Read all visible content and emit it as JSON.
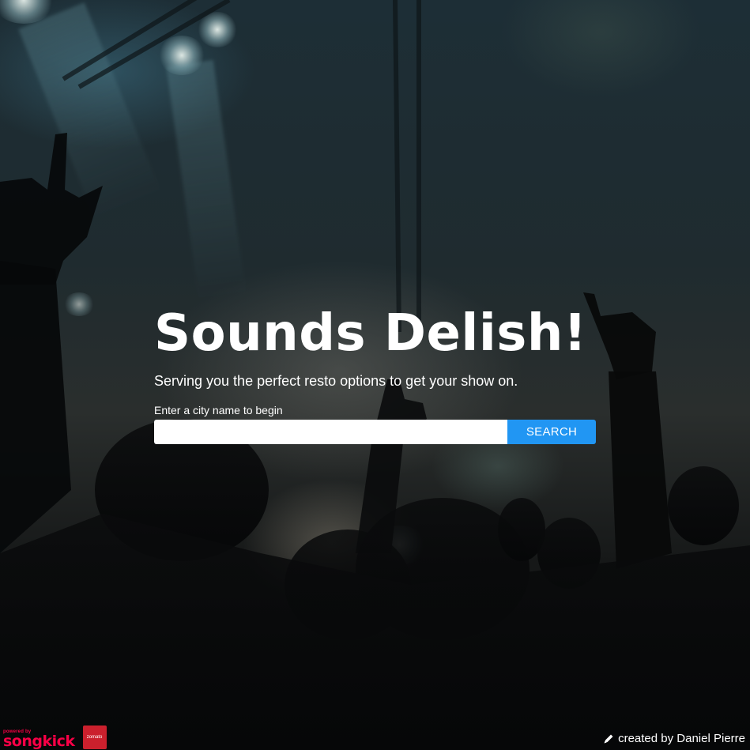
{
  "hero": {
    "title": "Sounds Delish!",
    "subtitle": "Serving you the perfect resto options to get your show on.",
    "prompt": "Enter a city name to begin"
  },
  "search": {
    "value": "",
    "placeholder": "",
    "button_label": "SEARCH"
  },
  "footer": {
    "powered_by": "powered by",
    "songkick_logo": "songkick",
    "zomato_logo": "zomato",
    "credit": "created by Daniel Pierre",
    "credit_icon": "pencil-icon"
  },
  "colors": {
    "accent": "#2196f3",
    "songkick": "#f80046",
    "zomato": "#cb202d",
    "text": "#ffffff"
  }
}
